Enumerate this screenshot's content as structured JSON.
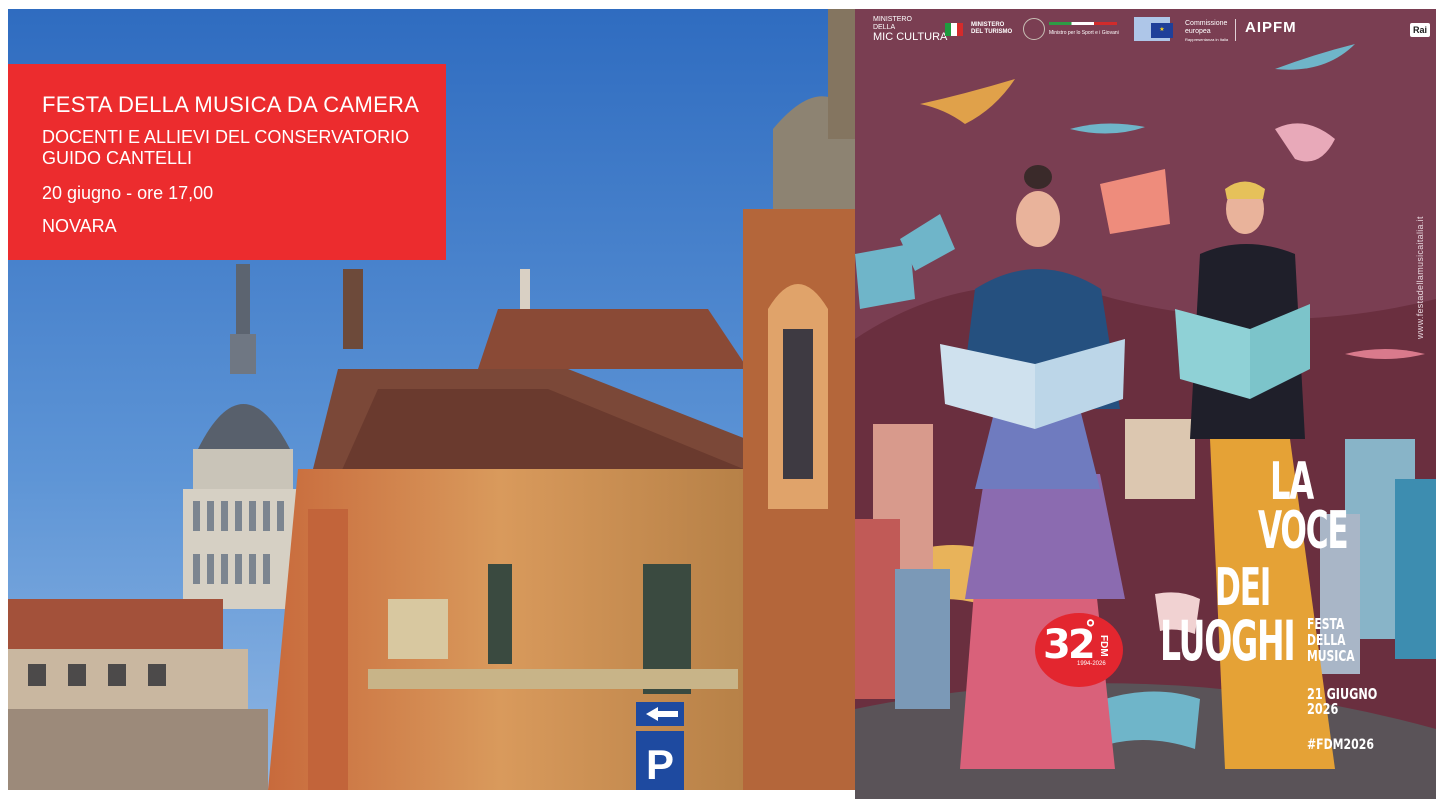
{
  "event_box": {
    "title": "FESTA DELLA MUSICA DA CAMERA",
    "performers_line1": "DOCENTI E ALLIEVI DEL CONSERVATORIO",
    "performers_line2": "GUIDO CANTELLI",
    "date_time": "20 giugno - ore 17,00",
    "city": "NOVARA",
    "box_color": "#ec2c2e"
  },
  "photo": {
    "icons": [
      "arrow-left-sign-icon",
      "parking-sign-icon"
    ],
    "parking_letter": "P"
  },
  "poster": {
    "background_color": "#7a3e52",
    "logos": {
      "mic_line1": "MINISTERO",
      "mic_line2": "DELLA",
      "mic_line3": "MIC CULTURA",
      "turismo_line1": "MINISTERO",
      "turismo_line2": "DEL TURISMO",
      "sport": "Ministro per lo Sport e i Giovani",
      "commissione_line1": "Commissione",
      "commissione_line2": "europea",
      "commissione_line3": "Rappresentanza in Italia",
      "aipfm": "AIPFM",
      "rai": "Rai"
    },
    "website": "www.festadellamusicaitalia.it",
    "title_line1": "LA",
    "title_line2": "VOCE",
    "title_line3": "DEI",
    "title_line4": "LUOGHI",
    "subtitle_line1": "FESTA",
    "subtitle_line2": "DELLA",
    "subtitle_line3": "MUSICA",
    "date_line1": "21 GIUGNO",
    "date_line2": "2026",
    "hashtag": "#FDM2026",
    "badge": {
      "number": "32",
      "degree": "°",
      "label": "FDM",
      "years": "1994-2026",
      "color": "#e3262f"
    }
  }
}
